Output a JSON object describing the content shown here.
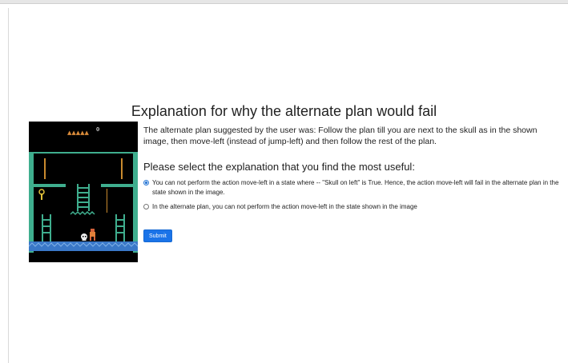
{
  "page": {
    "title": "Explanation for why the alternate plan would fail"
  },
  "game": {
    "score": "0",
    "lives_icons": "▲▲▲▲▲"
  },
  "plan": {
    "description": "The alternate plan suggested by the user was: Follow the plan till you are next to the skull as in the shown image, then move-left (instead of jump-left) and then follow the rest of the plan."
  },
  "question": {
    "prompt": "Please select the explanation that you find the most useful:",
    "options": [
      {
        "label": "You can not perform the action move-left in a state where -- \"Skull on left\" is True. Hence, the action move-left will fail in the alternate plan in the state shown in the image.",
        "checked": true
      },
      {
        "label": "In the alternate plan, you can not perform the action move-left in the state shown in the image",
        "checked": false
      }
    ],
    "submit_label": "Submit"
  },
  "colors": {
    "accent": "#1a73e8",
    "game_bg": "#000000",
    "game_green": "#3fae8e",
    "game_floor": "#3a78c8",
    "ladder_orange": "#c98a2e"
  }
}
